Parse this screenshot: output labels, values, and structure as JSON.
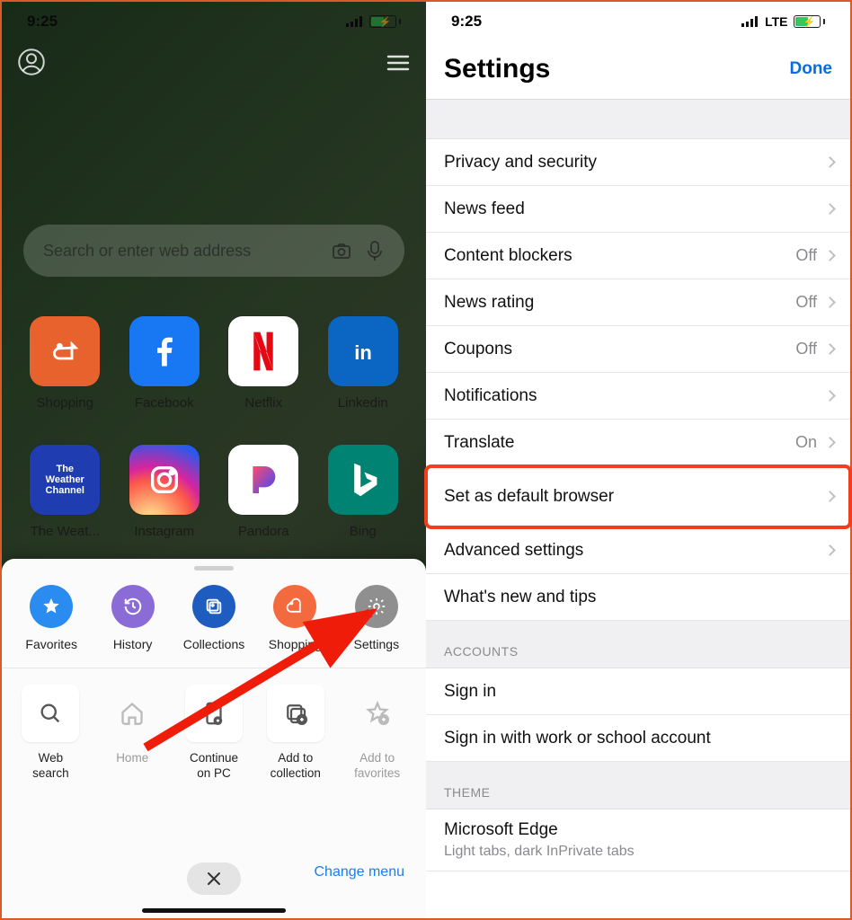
{
  "status": {
    "time": "9:25",
    "network": "LTE"
  },
  "left": {
    "search_placeholder": "Search or enter web address",
    "apps": [
      {
        "label": "Shopping"
      },
      {
        "label": "Facebook"
      },
      {
        "label": "Netflix"
      },
      {
        "label": "Linkedin"
      },
      {
        "label": "The Weat..."
      },
      {
        "label": "Instagram"
      },
      {
        "label": "Pandora"
      },
      {
        "label": "Bing"
      }
    ],
    "quick": {
      "favorites": "Favorites",
      "history": "History",
      "collections": "Collections",
      "shopping": "Shopping",
      "settings": "Settings"
    },
    "tools": {
      "web_search_l1": "Web",
      "web_search_l2": "search",
      "home": "Home",
      "continue_l1": "Continue",
      "continue_l2": "on PC",
      "addcol_l1": "Add to",
      "addcol_l2": "collection",
      "addfav_l1": "Add to",
      "addfav_l2": "favorites"
    },
    "change_menu": "Change menu"
  },
  "right": {
    "title": "Settings",
    "done": "Done",
    "rows": {
      "privacy": "Privacy and security",
      "newsfeed": "News feed",
      "content_blockers": {
        "label": "Content blockers",
        "value": "Off"
      },
      "news_rating": {
        "label": "News rating",
        "value": "Off"
      },
      "coupons": {
        "label": "Coupons",
        "value": "Off"
      },
      "notifications": "Notifications",
      "translate": {
        "label": "Translate",
        "value": "On"
      },
      "default_browser": "Set as default browser",
      "advanced": "Advanced settings",
      "whatsnew": "What's new and tips"
    },
    "accounts_header": "ACCOUNTS",
    "accounts": {
      "signin": "Sign in",
      "signin_work": "Sign in with work or school account"
    },
    "theme_header": "THEME",
    "theme": {
      "name": "Microsoft Edge",
      "sub": "Light tabs, dark InPrivate tabs"
    }
  }
}
